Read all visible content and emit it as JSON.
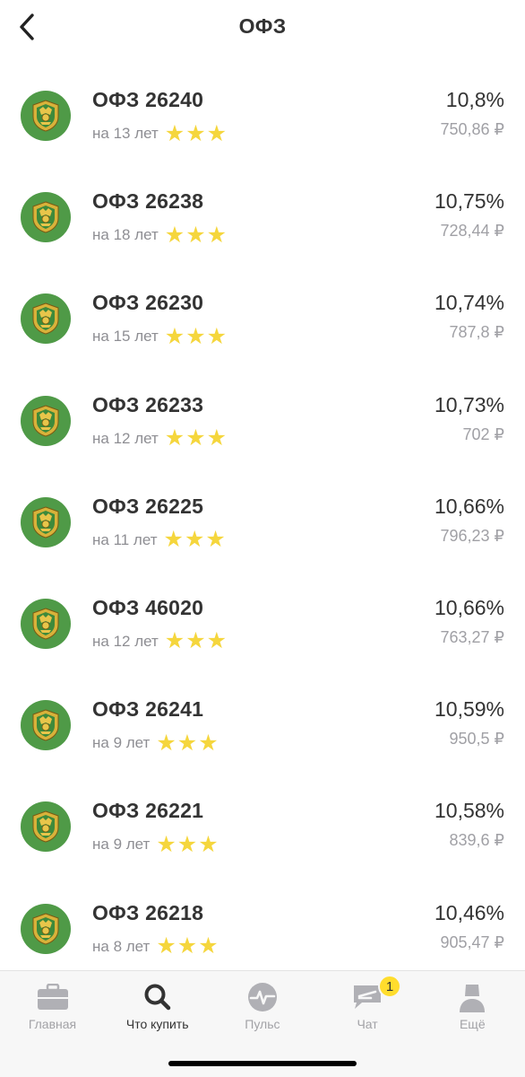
{
  "header": {
    "title": "ОФЗ"
  },
  "bonds": [
    {
      "name": "ОФЗ 26240",
      "term": "на 13 лет",
      "yield": "10,8%",
      "price": "750,86 ₽",
      "rating": 3
    },
    {
      "name": "ОФЗ 26238",
      "term": "на 18 лет",
      "yield": "10,75%",
      "price": "728,44 ₽",
      "rating": 3
    },
    {
      "name": "ОФЗ 26230",
      "term": "на 15 лет",
      "yield": "10,74%",
      "price": "787,8 ₽",
      "rating": 3
    },
    {
      "name": "ОФЗ 26233",
      "term": "на 12 лет",
      "yield": "10,73%",
      "price": "702 ₽",
      "rating": 3
    },
    {
      "name": "ОФЗ 26225",
      "term": "на 11 лет",
      "yield": "10,66%",
      "price": "796,23 ₽",
      "rating": 3
    },
    {
      "name": "ОФЗ 46020",
      "term": "на 12 лет",
      "yield": "10,66%",
      "price": "763,27 ₽",
      "rating": 3
    },
    {
      "name": "ОФЗ 26241",
      "term": "на 9 лет",
      "yield": "10,59%",
      "price": "950,5 ₽",
      "rating": 3
    },
    {
      "name": "ОФЗ 26221",
      "term": "на 9 лет",
      "yield": "10,58%",
      "price": "839,6 ₽",
      "rating": 3
    },
    {
      "name": "ОФЗ 26218",
      "term": "на 8 лет",
      "yield": "10,46%",
      "price": "905,47 ₽",
      "rating": 3
    }
  ],
  "tabbar": {
    "tabs": [
      {
        "label": "Главная",
        "icon": "briefcase-icon",
        "active": false
      },
      {
        "label": "Что купить",
        "icon": "search-icon",
        "active": true
      },
      {
        "label": "Пульс",
        "icon": "pulse-icon",
        "active": false
      },
      {
        "label": "Чат",
        "icon": "chat-icon",
        "active": false
      },
      {
        "label": "Ещё",
        "icon": "profile-icon",
        "active": false
      }
    ],
    "chat_badge": "1"
  },
  "colors": {
    "star": "#f5d63d",
    "logo_bg": "#4f9a47",
    "badge": "#ffdd2d",
    "muted_text": "#8e8e93"
  }
}
